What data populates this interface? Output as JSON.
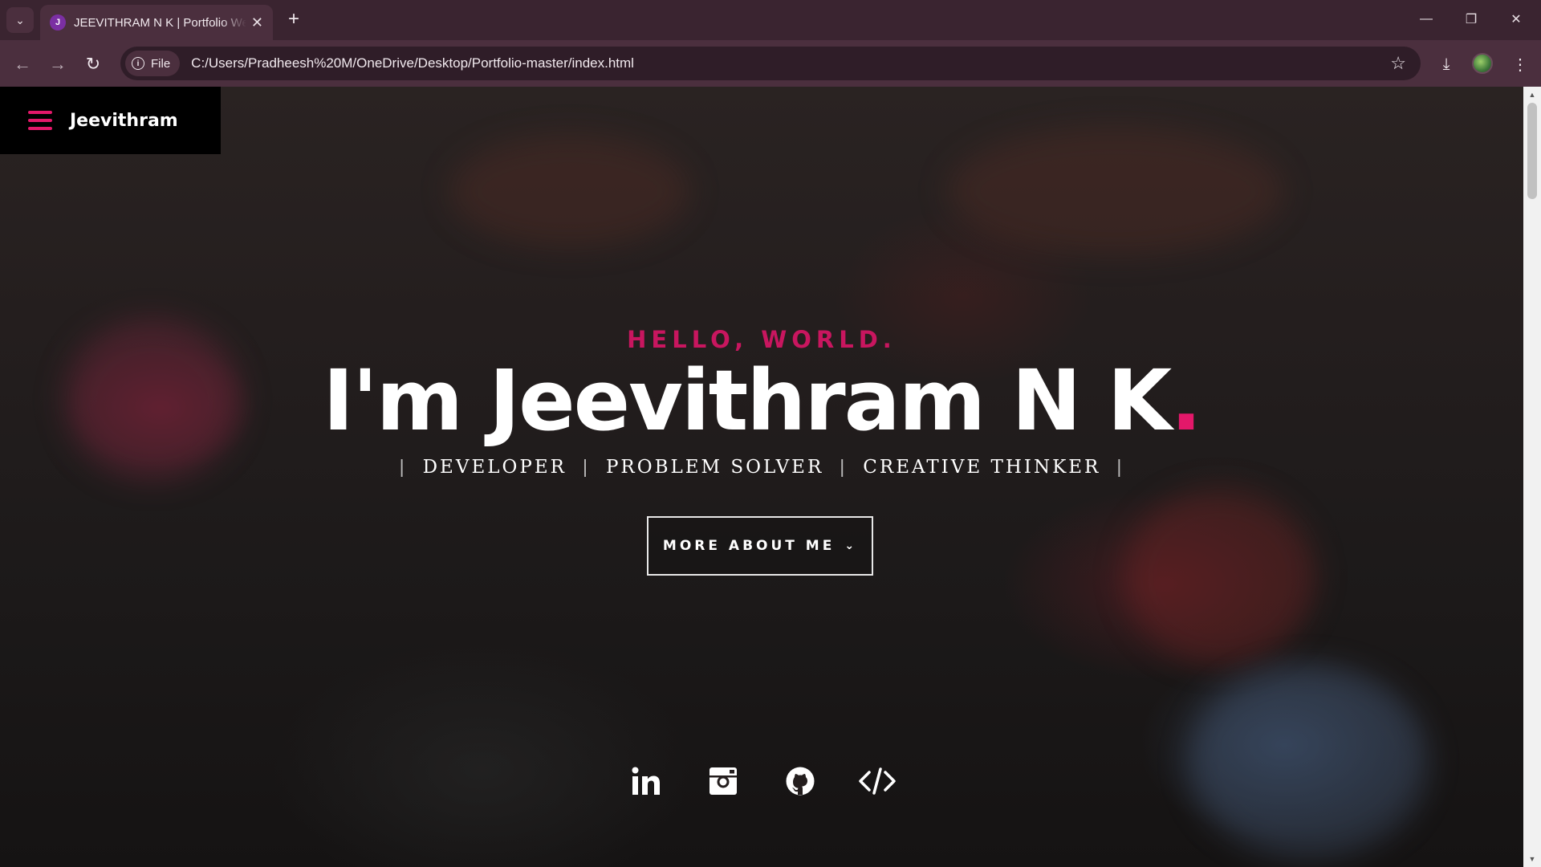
{
  "browser": {
    "tab_title": "JEEVITHRAM N K | Portfolio Website",
    "tab_favicon_letter": "J",
    "new_tab_icon": "plus-icon",
    "url_scheme_label": "File",
    "url": "C:/Users/Pradheesh%20M/OneDrive/Desktop/Portfolio-master/index.html"
  },
  "page": {
    "brand": "Jeevithram",
    "greeting": "HELLO, WORLD.",
    "headline": "I'm Jeevithram N K",
    "headline_dot": ".",
    "roles": [
      "DEVELOPER",
      "PROBLEM SOLVER",
      "CREATIVE THINKER"
    ],
    "cta_label": "MORE ABOUT ME",
    "socials": [
      "linkedin-icon",
      "instagram-icon",
      "github-icon",
      "code-icon"
    ]
  },
  "colors": {
    "accent": "#e3186a",
    "chrome_bg": "#3a2430",
    "toolbar_bg": "#4b2f3e"
  }
}
